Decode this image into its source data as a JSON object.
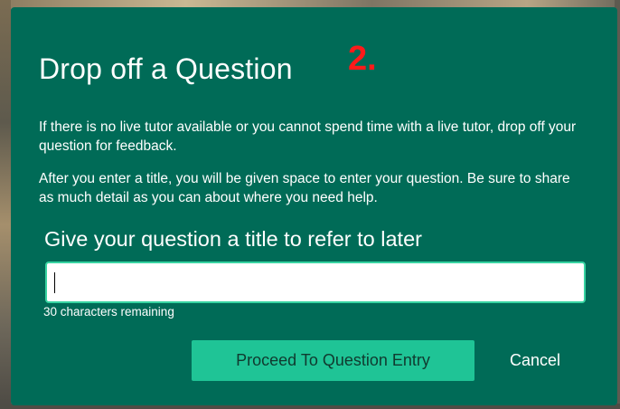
{
  "modal": {
    "title": "Drop off a Question",
    "step_marker": "2.",
    "paragraph_1": "If there is no live tutor available or you cannot spend time with a live tutor, drop off your question for feedback.",
    "paragraph_2": "After you enter a title, you will be given space to enter your question. Be sure to share as much detail as you can about where you need help.",
    "field_label": "Give your question a title to refer to later",
    "title_input": {
      "value": "",
      "placeholder": ""
    },
    "counter": "30 characters remaining",
    "buttons": {
      "proceed_label": "Proceed To Question Entry",
      "cancel_label": "Cancel"
    }
  },
  "colors": {
    "modal_bg": "#006b57",
    "accent": "#1fc496",
    "input_border": "#38d4a2",
    "step_marker": "#ff1a1a"
  }
}
